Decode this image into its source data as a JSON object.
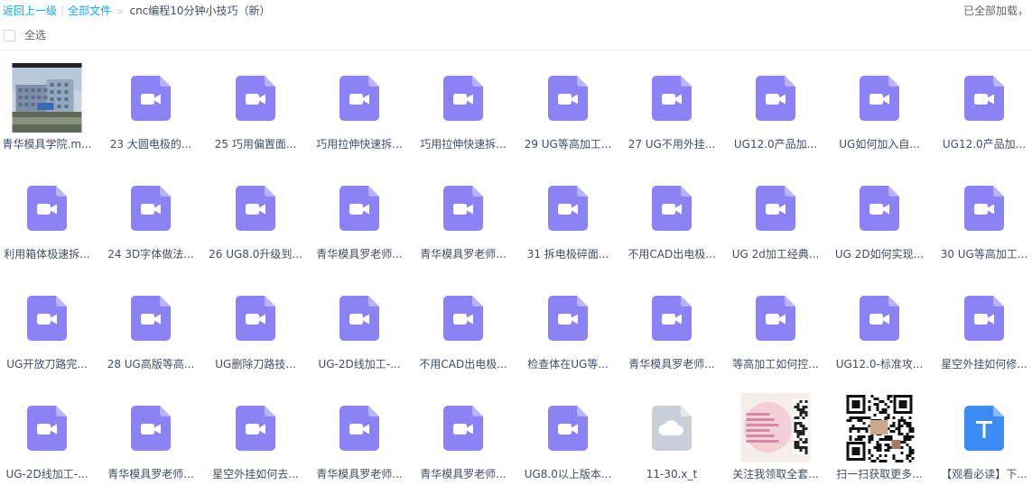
{
  "breadcrumb": {
    "back": "返回上一级",
    "all_files": "全部文件",
    "current": "cnc编程10分钟小技巧（新）"
  },
  "status": {
    "loaded_text": "已全部加载，"
  },
  "select_all": {
    "label": "全选"
  },
  "colors": {
    "video_icon": "#8b82f5",
    "video_icon_fold": "#b9b3fb",
    "link": "#09aaff",
    "doc_blue": "#3b8cf5",
    "cloud_gray": "#c8cfd8"
  },
  "files": [
    {
      "name": "青华模具学院.m...",
      "type": "photo"
    },
    {
      "name": "23 大圆电极的...",
      "type": "video"
    },
    {
      "name": "25 巧用偏置面...",
      "type": "video"
    },
    {
      "name": "巧用拉伸快速拆...",
      "type": "video"
    },
    {
      "name": "巧用拉伸快速拆...",
      "type": "video"
    },
    {
      "name": "29 UG等高加工...",
      "type": "video"
    },
    {
      "name": "27 UG不用外挂...",
      "type": "video"
    },
    {
      "name": "UG12.0产品加...",
      "type": "video"
    },
    {
      "name": "UG如何加入自...",
      "type": "video"
    },
    {
      "name": "UG12.0产品加...",
      "type": "video"
    },
    {
      "name": "利用箱体极速拆...",
      "type": "video"
    },
    {
      "name": "24 3D字体做法...",
      "type": "video"
    },
    {
      "name": "26 UG8.0升级到...",
      "type": "video"
    },
    {
      "name": "青华模具罗老师...",
      "type": "video"
    },
    {
      "name": "青华模具罗老师...",
      "type": "video"
    },
    {
      "name": "31 拆电极碎面...",
      "type": "video"
    },
    {
      "name": "不用CAD出电极...",
      "type": "video"
    },
    {
      "name": "UG 2d加工经典...",
      "type": "video"
    },
    {
      "name": "UG 2D如何实现...",
      "type": "video"
    },
    {
      "name": "30 UG等高加工...",
      "type": "video"
    },
    {
      "name": "UG开放刀路完...",
      "type": "video"
    },
    {
      "name": "28 UG高版等高...",
      "type": "video"
    },
    {
      "name": "UG删除刀路技...",
      "type": "video"
    },
    {
      "name": "UG-2D线加工-...",
      "type": "video"
    },
    {
      "name": "不用CAD出电极...",
      "type": "video"
    },
    {
      "name": "检查体在UG等...",
      "type": "video"
    },
    {
      "name": "青华模具罗老师...",
      "type": "video"
    },
    {
      "name": "等高加工如何控...",
      "type": "video"
    },
    {
      "name": "UG12.0-标准攻...",
      "type": "video"
    },
    {
      "name": "星空外挂如何修...",
      "type": "video"
    },
    {
      "name": "UG-2D线加工-...",
      "type": "video"
    },
    {
      "name": "青华模具罗老师...",
      "type": "video"
    },
    {
      "name": "星空外挂如何去...",
      "type": "video"
    },
    {
      "name": "青华模具罗老师...",
      "type": "video"
    },
    {
      "name": "青华模具罗老师...",
      "type": "video"
    },
    {
      "name": "UG8.0以上版本...",
      "type": "video"
    },
    {
      "name": "11-30.x_t",
      "type": "cloud"
    },
    {
      "name": "关注我领取全套...",
      "type": "poster"
    },
    {
      "name": "扫一扫获取更多...",
      "type": "qr"
    },
    {
      "name": "【观看必读】下...",
      "type": "doc"
    }
  ]
}
